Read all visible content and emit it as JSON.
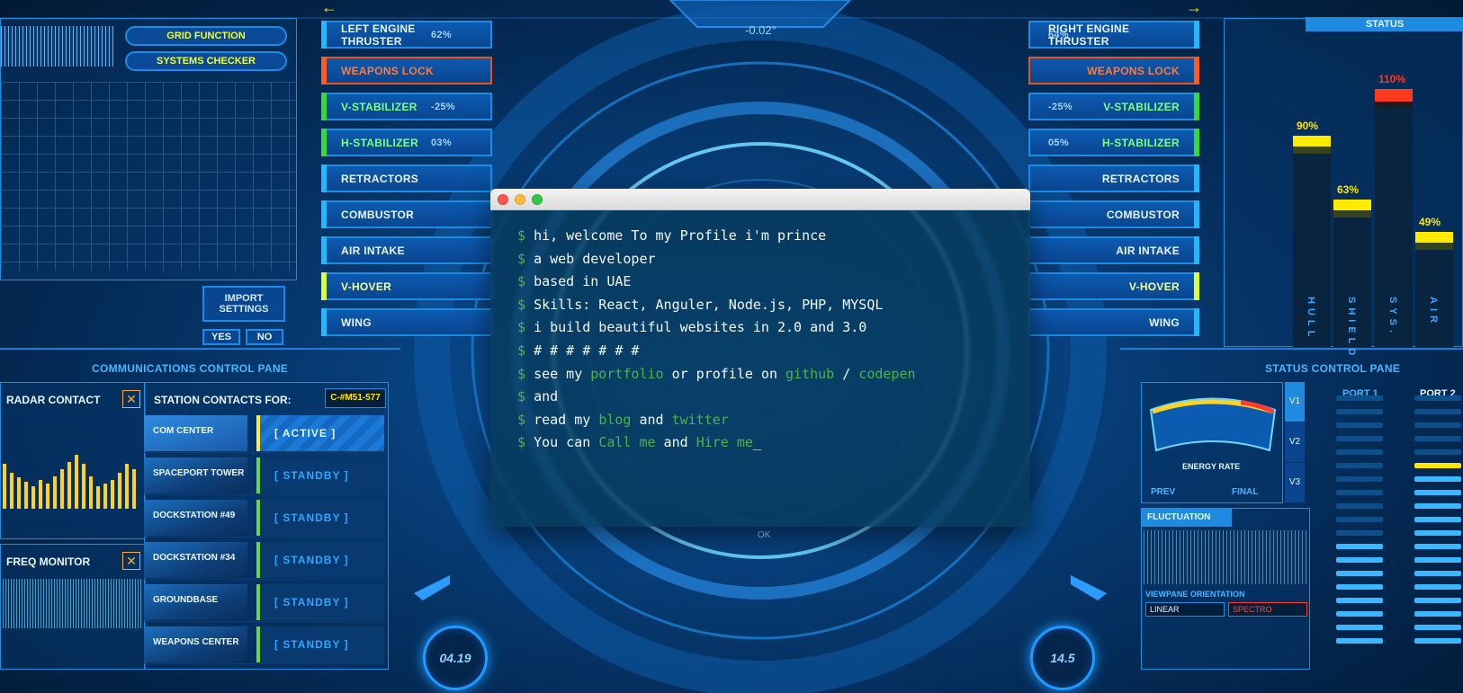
{
  "hud": {
    "top_arrows": [
      "←",
      "→"
    ],
    "heading": "-0.02°",
    "left_buttons": [
      {
        "label": "LEFT ENGINE THRUSTER",
        "value": "62%",
        "style": "blue"
      },
      {
        "label": "WEAPONS LOCK",
        "value": "",
        "style": "orange"
      },
      {
        "label": "V-STABILIZER",
        "value": "-25%",
        "style": "green"
      },
      {
        "label": "H-STABILIZER",
        "value": "03%",
        "style": "green"
      },
      {
        "label": "RETRACTORS",
        "value": "",
        "style": "blue"
      },
      {
        "label": "COMBUSTOR",
        "value": "",
        "style": "blue"
      },
      {
        "label": "AIR INTAKE",
        "value": "",
        "style": "blue"
      },
      {
        "label": "V-HOVER",
        "value": "",
        "style": "yellow"
      },
      {
        "label": "WING",
        "value": "",
        "style": "blue"
      }
    ],
    "right_buttons": [
      {
        "label": "RIGHT ENGINE THRUSTER",
        "value": "64%",
        "style": "blue"
      },
      {
        "label": "WEAPONS LOCK",
        "value": "",
        "style": "orange"
      },
      {
        "label": "V-STABILIZER",
        "value": "-25%",
        "style": "green"
      },
      {
        "label": "H-STABILIZER",
        "value": "05%",
        "style": "green"
      },
      {
        "label": "RETRACTORS",
        "value": "",
        "style": "blue"
      },
      {
        "label": "COMBUSTOR",
        "value": "",
        "style": "blue"
      },
      {
        "label": "AIR INTAKE",
        "value": "",
        "style": "blue"
      },
      {
        "label": "V-HOVER",
        "value": "",
        "style": "yellow"
      },
      {
        "label": "WING",
        "value": "",
        "style": "blue"
      }
    ],
    "grid_function": "GRID FUNCTION",
    "systems_checker": "SYSTEMS CHECKER",
    "import_settings": "IMPORT SETTINGS",
    "yes": "YES",
    "no": "NO",
    "comm_pane": "COMMUNICATIONS CONTROL PANE",
    "status_pane": "STATUS CONTROL PANE",
    "radar_contact": "RADAR CONTACT",
    "freq_monitor": "FREQ MONITOR",
    "station_contacts": "STATION CONTACTS FOR:",
    "station_code": "C-#M51-577",
    "stations": [
      {
        "name": "COM CENTER",
        "state": "[ ACTIVE ]",
        "active": true
      },
      {
        "name": "SPACEPORT TOWER",
        "state": "[ STANDBY ]",
        "active": false
      },
      {
        "name": "DOCKSTATION #49",
        "state": "[ STANDBY ]",
        "active": false
      },
      {
        "name": "DOCKSTATION #34",
        "state": "[ STANDBY ]",
        "active": false
      },
      {
        "name": "GROUNDBASE",
        "state": "[ STANDBY ]",
        "active": false
      },
      {
        "name": "WEAPONS CENTER",
        "state": "[ STANDBY ]",
        "active": false
      }
    ],
    "status_title": "STATUS",
    "status_bars": [
      {
        "name": "HULL",
        "percent": 90,
        "label": "90%"
      },
      {
        "name": "SHIELD",
        "percent": 63,
        "label": "63%"
      },
      {
        "name": "SYS.",
        "percent": 110,
        "label": "110%"
      },
      {
        "name": "AIR",
        "percent": 49,
        "label": "49%"
      }
    ],
    "energy_rate": "ENERGY RATE",
    "prev": "PREV",
    "final": "FINAL",
    "fluctuation": "FLUCTUATION",
    "viewpane_orientation": "VIEWPANE ORIENTATION",
    "linear": "LINEAR",
    "spectro": "SPECTRO",
    "port1": "PORT 1",
    "port2": "PORT 2",
    "dial_left": "04.19",
    "dial_right": "14.5",
    "ok": "OK",
    "v_tabs": [
      "V1",
      "V2",
      "V3"
    ]
  },
  "terminal": {
    "lines": [
      {
        "parts": [
          {
            "t": "hi, welcome To my Profile i'm prince"
          }
        ]
      },
      {
        "parts": [
          {
            "t": "a web developer"
          }
        ]
      },
      {
        "parts": [
          {
            "t": "based in UAE"
          }
        ]
      },
      {
        "parts": [
          {
            "t": "Skills: React, Anguler, Node.js, PHP, MYSQL"
          }
        ]
      },
      {
        "parts": [
          {
            "t": "i build beautiful websites in 2.0 and 3.0"
          }
        ]
      },
      {
        "parts": [
          {
            "t": "# # # # # # #"
          }
        ]
      },
      {
        "parts": [
          {
            "t": "see my "
          },
          {
            "t": "portfolio",
            "link": true
          },
          {
            "t": " or profile on "
          },
          {
            "t": "github",
            "link": true
          },
          {
            "t": " / "
          },
          {
            "t": "codepen",
            "link": true
          }
        ]
      },
      {
        "parts": [
          {
            "t": "and"
          }
        ]
      },
      {
        "parts": [
          {
            "t": "read my "
          },
          {
            "t": "blog",
            "link": true
          },
          {
            "t": " and "
          },
          {
            "t": "twitter",
            "link": true
          }
        ]
      },
      {
        "parts": [
          {
            "t": "You can "
          },
          {
            "t": "Call me",
            "link": true
          },
          {
            "t": " and "
          },
          {
            "t": "Hire me",
            "link": true
          },
          {
            "t": "_",
            "cursor": true
          }
        ]
      }
    ],
    "prompt": "$"
  }
}
